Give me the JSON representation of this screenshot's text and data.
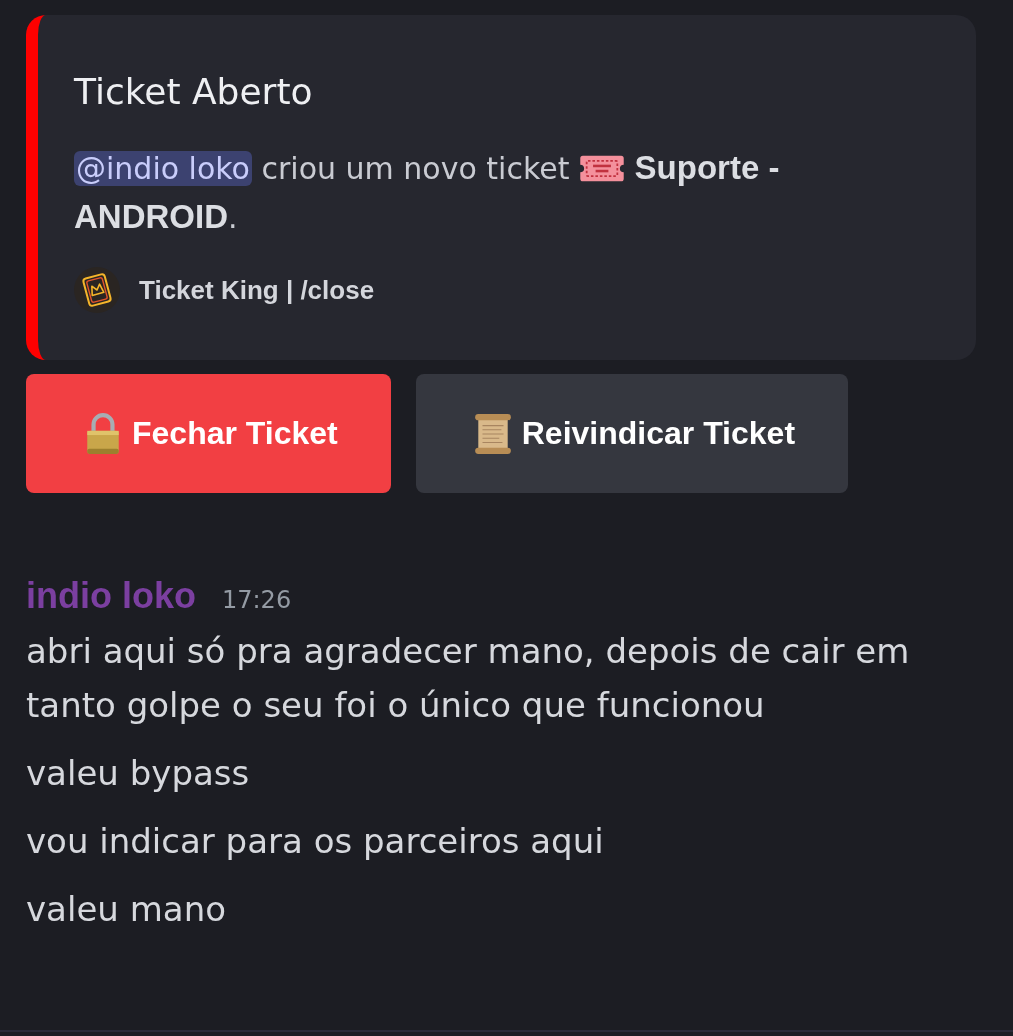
{
  "embed": {
    "title": "Ticket Aberto",
    "description": [
      {
        "kind": "mention",
        "text": "@indio loko"
      },
      {
        "kind": "text",
        "text": " criou um novo ticket "
      },
      {
        "kind": "ticket-icon"
      },
      {
        "kind": "text",
        "text": " **Suporte - ANDROID**."
      }
    ],
    "footer": {
      "text": "Ticket King | /close"
    }
  },
  "buttons": [
    {
      "kind": "lock",
      "label": "Fechar Ticket"
    },
    {
      "kind": "scroll",
      "label": "Reivindicar Ticket"
    }
  ],
  "message": {
    "author": "indio loko",
    "time": "17:26",
    "lines": [
      "abri aqui só pra agradecer mano, depois de cair em tanto golpe o seu foi o único que funcionou",
      "valeu bypass",
      "vou indicar para os parceiros aqui",
      "valeu mano"
    ]
  }
}
